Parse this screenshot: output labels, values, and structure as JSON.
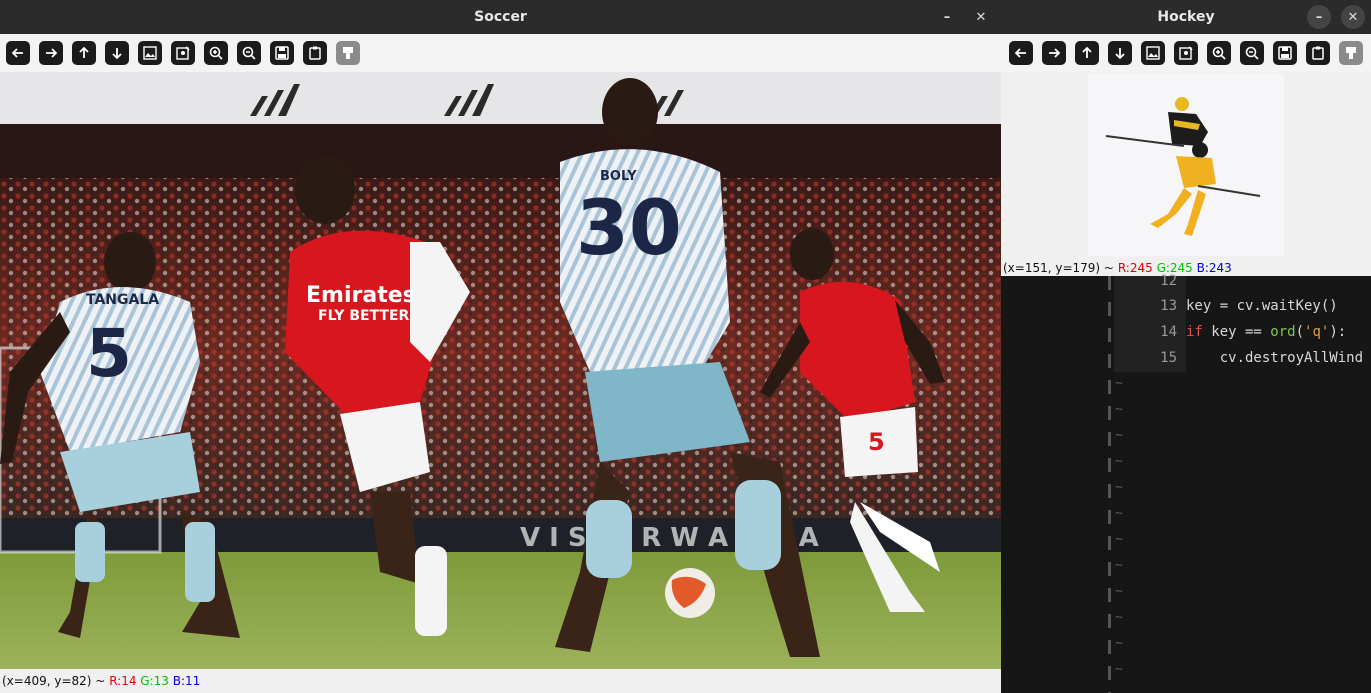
{
  "soccer_window": {
    "title": "Soccer",
    "minimize_glyph": "–",
    "close_glyph": "✕",
    "status": {
      "coords": "(x=409, y=82) ~",
      "r": "R:14",
      "g": "G:13",
      "b": "B:11"
    },
    "image": {
      "players": [
        {
          "name": "TANGALA",
          "number": "5"
        },
        {
          "name": "BOLY",
          "number": "30"
        }
      ],
      "sponsor_line1": "Emirates",
      "sponsor_line2": "FLY BETTER",
      "right_player_number": "5"
    }
  },
  "hockey_window": {
    "title": "Hockey",
    "minimize_glyph": "–",
    "close_glyph": "✕",
    "status": {
      "coords": "(x=151, y=179) ~",
      "r": "R:245",
      "g": "G:245",
      "b": "B:243"
    }
  },
  "toolbar_tools": [
    "arrow-left",
    "arrow-right",
    "arrow-up",
    "arrow-down",
    "image",
    "image-edit",
    "zoom-in",
    "zoom-out",
    "save",
    "copy",
    "properties"
  ],
  "editor": {
    "lines": [
      {
        "number": "12",
        "code": ""
      },
      {
        "number": "13",
        "code": "key = cv.waitKey()"
      },
      {
        "number": "14",
        "kw": "if",
        "code_mid": " key == ",
        "fn": "ord",
        "open": "(",
        "str": "'q'",
        "close": "):"
      },
      {
        "number": "15",
        "code": "    cv.destroyAllWind"
      }
    ],
    "empty_marker": "~"
  },
  "colors": {
    "titlebar": "#2b2b2b",
    "toolbar_bg": "#f3f3f3",
    "editor_bg": "#161616",
    "arsenal_red": "#d7161d"
  }
}
